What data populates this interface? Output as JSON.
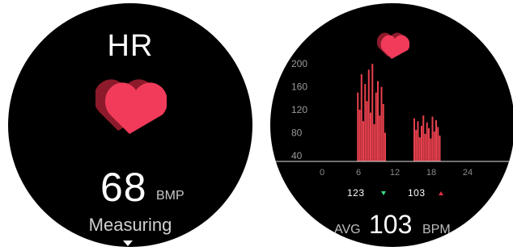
{
  "colors": {
    "heart_front": "#f23b5a",
    "heart_back": "#8c1a2b",
    "bar": "#e8404d",
    "up_indicator": "#e0303f",
    "down_indicator": "#3ddc84"
  },
  "measure_screen": {
    "title": "HR",
    "icon": "heart-icon",
    "value": "68",
    "unit": "BMP",
    "status": "Measuring",
    "scroll_icon": "chevron-down-icon"
  },
  "history_screen": {
    "icon": "heart-icon",
    "min_value": "123",
    "max_value": "103",
    "avg_label": "AVG",
    "avg_value": "103",
    "avg_unit": "BPM"
  },
  "chart_data": {
    "type": "bar",
    "y_ticks": [
      "200",
      "160",
      "120",
      "80",
      "40"
    ],
    "x_ticks": [
      "0",
      "6",
      "12",
      "18",
      "24"
    ],
    "xlim": [
      0,
      24
    ],
    "ylim": [
      30,
      210
    ],
    "grid": false,
    "x": [
      5.9,
      6.2,
      6.5,
      6.8,
      7.1,
      7.4,
      7.7,
      8.0,
      8.3,
      8.6,
      8.9,
      9.2,
      9.5,
      9.8,
      10.1,
      10.4,
      15.2,
      15.5,
      15.8,
      16.1,
      16.4,
      16.7,
      17.0,
      17.3,
      17.6,
      17.9,
      18.2,
      18.5,
      18.8,
      19.1,
      19.4
    ],
    "values": [
      150,
      120,
      182,
      100,
      165,
      135,
      190,
      115,
      200,
      95,
      150,
      170,
      110,
      160,
      130,
      80,
      105,
      85,
      100,
      72,
      92,
      110,
      78,
      98,
      88,
      70,
      108,
      82,
      102,
      90,
      75
    ]
  }
}
